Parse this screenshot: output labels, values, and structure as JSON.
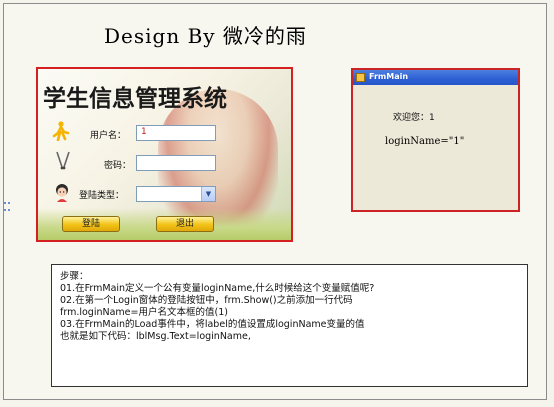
{
  "heading": "Design By 微冷的雨",
  "login_window": {
    "system_title": "学生信息管理系统",
    "username_label": "用户名：",
    "username_value": "1",
    "password_label": "密码：",
    "password_value": "",
    "login_type_label": "登陆类型：",
    "login_type_value": "",
    "login_button": "登陆",
    "exit_button": "退出"
  },
  "main_window": {
    "title": "FrmMain",
    "welcome": "欢迎您：1",
    "login_name_text": "loginName=\"1\""
  },
  "steps": {
    "header": "步骤：",
    "lines": [
      "01.在FrmMain定义一个公有变量loginName,什么时候给这个变量赋值呢?",
      "02.在第一个Login窗体的登陆按钮中，frm.Show()之前添加一行代码",
      "frm.loginName=用户名文本框的值(1)",
      " 03.在FrmMain的Load事件中，将label的值设置成loginName变量的值",
      " 也就是如下代码：lblMsg.Text=loginName,"
    ]
  },
  "colors": {
    "window_border": "#d42020",
    "titlebar": "#2d5fd3",
    "button": "#f2c316"
  },
  "icons": [
    "person-running-icon",
    "key-icon",
    "user-avatar-icon",
    "chevron-down-icon",
    "app-icon"
  ]
}
